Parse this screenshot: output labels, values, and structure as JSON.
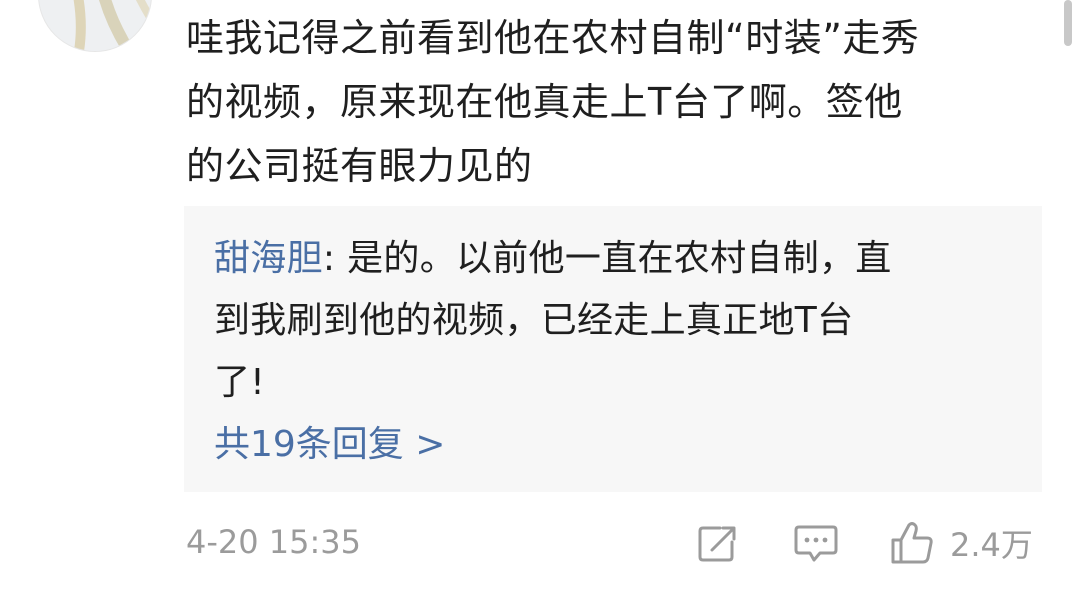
{
  "comment": {
    "lines": [
      "哇我记得之前看到他在农村自制“时装”走秀",
      "的视频，原来现在他真走上T台了啊。签他",
      "的公司挺有眼力见的"
    ]
  },
  "reply": {
    "author": "甜海胆",
    "separator": ": ",
    "lines": [
      "是的。以前他一直在农村自制，直",
      "到我刷到他的视频，已经走上真正地T台",
      "了!"
    ],
    "more_label": "共19条回复 >"
  },
  "footer": {
    "timestamp": "4-20 15:35",
    "like_count": "2.4万",
    "icons": {
      "share": "share-icon",
      "comment": "comment-icon",
      "like": "thumbs-up-icon"
    },
    "icon_color": "#9b9b9b"
  },
  "colors": {
    "link": "#4a6fa5",
    "text": "#1f1f1f",
    "muted": "#9b9b9b",
    "reply_bg": "#f7f7f7"
  }
}
